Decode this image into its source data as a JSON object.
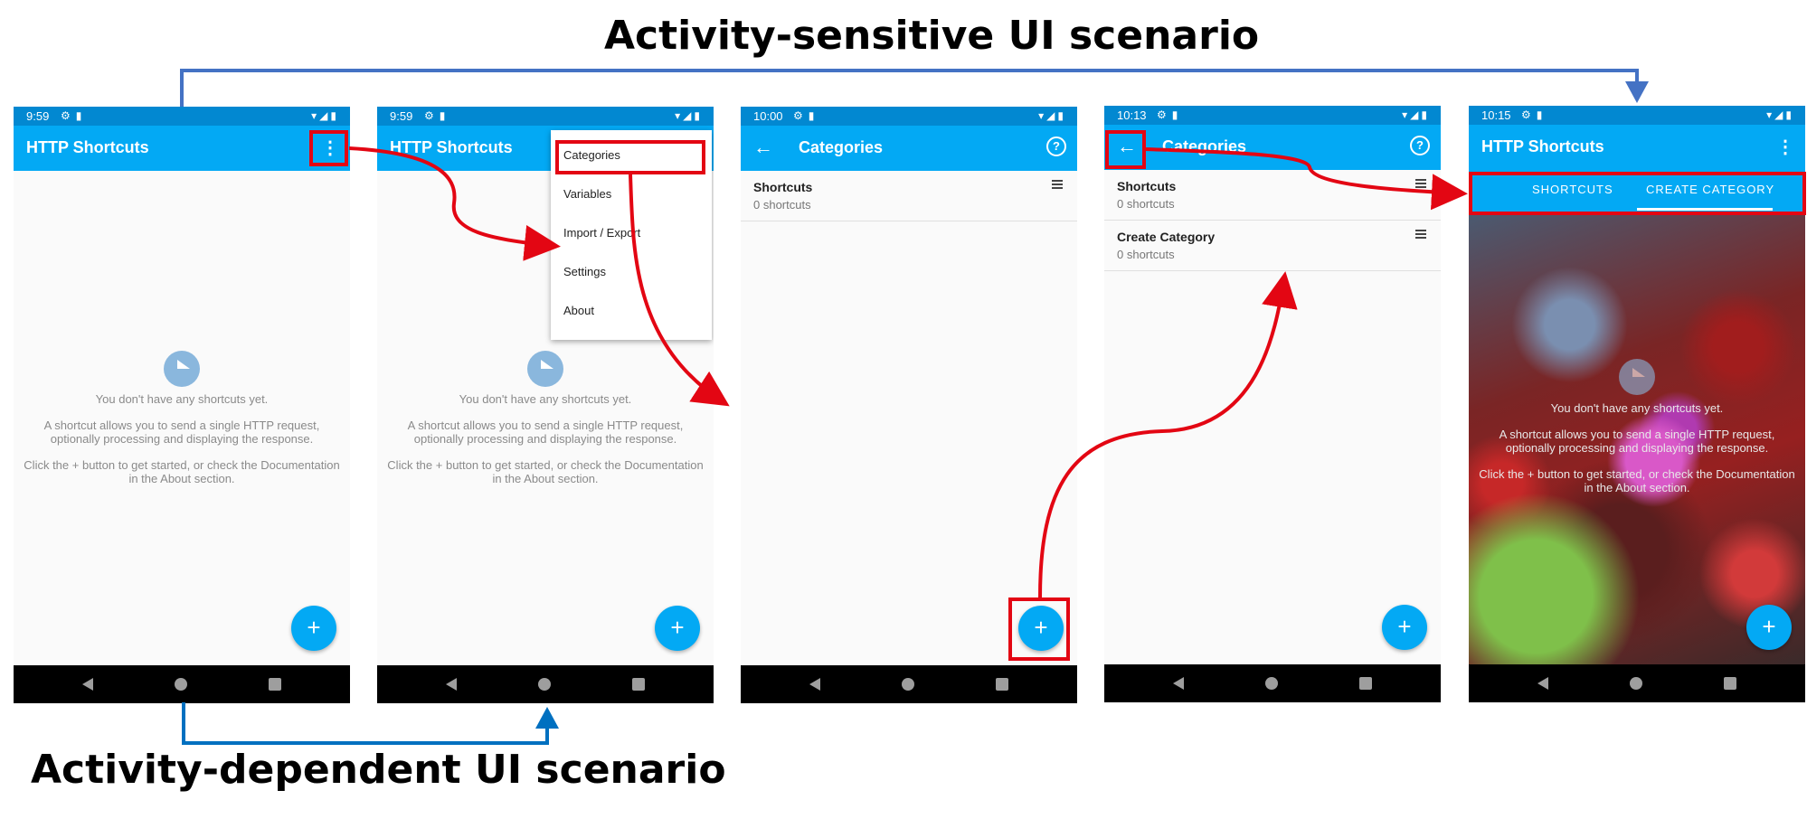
{
  "headings": {
    "top": "Activity-sensitive UI scenario",
    "bottom": "Activity-dependent UI scenario"
  },
  "colors": {
    "status_bar": "#0288d1",
    "app_bar": "#03a9f4",
    "highlight_red": "#e30613",
    "arrow_blue": "#4472c4",
    "arrow_blue_dark": "#0070c0"
  },
  "screens": [
    {
      "time": "9:59",
      "title": "HTTP Shortcuts",
      "empty": {
        "line1": "You don't have any shortcuts yet.",
        "line2": "A shortcut allows you to send a single HTTP request,",
        "line3": "optionally processing and displaying the response.",
        "line4": "Click the + button to get started, or check the Documentation",
        "line5": "in the About section."
      },
      "fab": "+"
    },
    {
      "time": "9:59",
      "title": "HTTP Shortcuts",
      "menu": [
        "Categories",
        "Variables",
        "Import / Export",
        "Settings",
        "About"
      ],
      "empty": {
        "line1": "You don't have any shortcuts yet.",
        "line2": "A shortcut allows you to send a single HTTP request,",
        "line3": "optionally processing and displaying the response.",
        "line4": "Click the + button to get started, or check the Documentation",
        "line5": "in the About section."
      },
      "fab": "+"
    },
    {
      "time": "10:00",
      "title": "Categories",
      "categories": [
        {
          "name": "Shortcuts",
          "count": "0 shortcuts"
        }
      ],
      "fab": "+"
    },
    {
      "time": "10:13",
      "title": "Categories",
      "categories": [
        {
          "name": "Shortcuts",
          "count": "0 shortcuts"
        },
        {
          "name": "Create Category",
          "count": "0 shortcuts"
        }
      ],
      "fab": "+"
    },
    {
      "time": "10:15",
      "title": "HTTP Shortcuts",
      "tabs": [
        "SHORTCUTS",
        "CREATE CATEGORY"
      ],
      "empty": {
        "line1": "You don't have any shortcuts yet.",
        "line2": "A shortcut allows you to send a single HTTP request,",
        "line3": "optionally processing and displaying the response.",
        "line4": "Click the + button to get started, or check the Documentation",
        "line5": "in the About section."
      },
      "fab": "+"
    }
  ]
}
